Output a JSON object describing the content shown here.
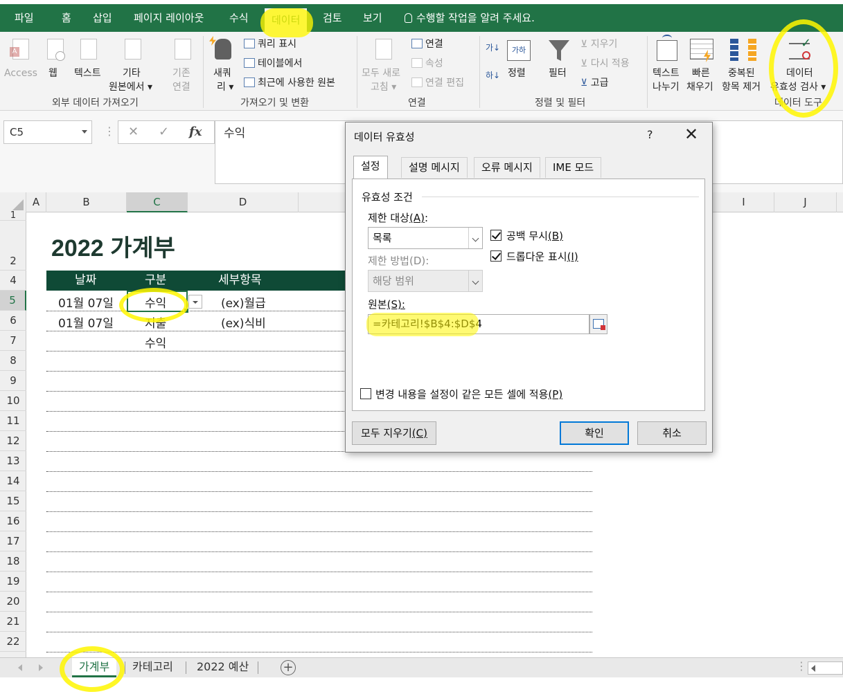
{
  "ribbon_tabs": [
    "파일",
    "홈",
    "삽입",
    "페이지 레이아웃",
    "수식",
    "데이터",
    "검토",
    "보기"
  ],
  "tell_me": "수행할 작업을 알려 주세요.",
  "ribbon": {
    "external_data": {
      "access": "Access",
      "web": "웹",
      "text": "텍스트",
      "other_l1": "기타",
      "other_l2": "원본에서",
      "existing_l1": "기존",
      "existing_l2": "연결",
      "group_label": "외부 데이터 가져오기"
    },
    "get_transform": {
      "new_query_l1": "새쿼",
      "new_query_l2": "리",
      "show_queries": "쿼리 표시",
      "from_table": "테이블에서",
      "recent_sources": "최근에 사용한 원본",
      "group_label": "가져오기 및 변환"
    },
    "connections": {
      "refresh_l1": "모두 새로",
      "refresh_l2": "고침",
      "connections": "연결",
      "properties": "속성",
      "edit_links": "연결 편집",
      "group_label": "연결"
    },
    "sort_filter": {
      "sort": "정렬",
      "filter": "필터",
      "clear": "지우기",
      "reapply": "다시 적용",
      "advanced": "고급",
      "group_label": "정렬 및 필터"
    },
    "data_tools": {
      "text_to_cols_l1": "텍스트",
      "text_to_cols_l2": "나누기",
      "flash_fill_l1": "빠른",
      "flash_fill_l2": "채우기",
      "remove_dup_l1": "중복된",
      "remove_dup_l2": "항목 제거",
      "validation_l1": "데이터",
      "validation_l2": "유효성 검사",
      "group_label": "데이터 도구"
    }
  },
  "formula_bar": {
    "name_box": "C5",
    "cancel": "✕",
    "enter": "✓",
    "fx": "fx",
    "content": "수익"
  },
  "columns": [
    "A",
    "B",
    "C",
    "D",
    "I",
    "J"
  ],
  "rows": [
    "1",
    "2",
    "4",
    "5",
    "6",
    "7",
    "8",
    "9",
    "10",
    "11",
    "12",
    "13",
    "14",
    "15",
    "16",
    "17",
    "18",
    "19",
    "20",
    "21",
    "22"
  ],
  "sheet": {
    "title": "2022 가계부",
    "headers": [
      "날짜",
      "구분",
      "세부항목"
    ],
    "table_rows": [
      {
        "date": "01월 07일",
        "category": "수익",
        "detail": "(ex)월급"
      },
      {
        "date": "01월 07일",
        "category": "지출",
        "detail": "(ex)식비"
      },
      {
        "date": "",
        "category": "수익",
        "detail": ""
      }
    ]
  },
  "sheet_tabs": [
    "가계부",
    "카테고리",
    "2022 예산"
  ],
  "dialog": {
    "title": "데이터 유효성",
    "help": "?",
    "close": "✕",
    "tabs": [
      "설정",
      "설명 메시지",
      "오류 메시지",
      "IME 모드"
    ],
    "group_title": "유효성 조건",
    "allow_label": "제한 대상",
    "allow_key": "(A)",
    "allow_value": "목록",
    "ignore_blank": "공백 무시",
    "ignore_blank_key": "(B)",
    "dropdown": "드롭다운 표시",
    "dropdown_key": "(I)",
    "data_label": "제한 방법(D):",
    "data_value": "해당 범위",
    "source_label": "원본",
    "source_key": "(S):",
    "source_value": "=카테고리!$B$4:$D$4",
    "apply_all": "변경 내용을 설정이 같은 모든 셀에 적용",
    "apply_all_key": "(P)",
    "clear_all": "모두 지우기",
    "clear_all_key": "(C)",
    "ok": "확인",
    "cancel": "취소"
  },
  "colors": {
    "excel_green": "#217346",
    "header_band": "#0f4a36",
    "highlight": "#fff600"
  }
}
